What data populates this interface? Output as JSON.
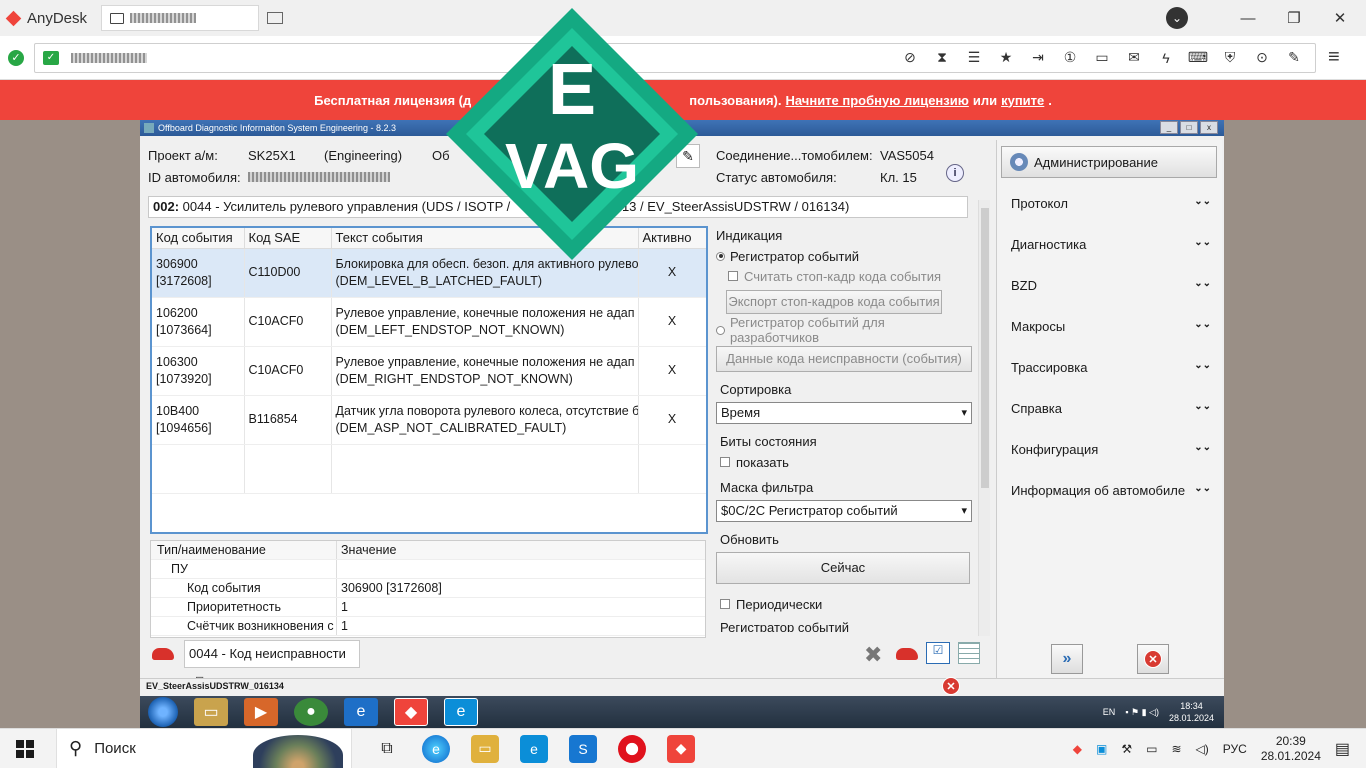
{
  "anydesk": {
    "app_name": "AnyDesk",
    "window_controls": {
      "minimize": "—",
      "maximize": "❐",
      "close": "✕"
    },
    "banner": {
      "text_start": "Бесплатная лицензия (д",
      "text_mid": "пользования).",
      "trial_link": "Начните пробную лицензию",
      "or": "или",
      "buy_link": "купите",
      "end": "."
    },
    "accent_color": "#ef443b"
  },
  "odis": {
    "window_title": "Offboard Diagnostic Information System Engineering - 8.2.3",
    "project_label": "Проект а/м:",
    "project_value": "SK25X1",
    "project_mode": "(Engineering)",
    "project_extra": "Об",
    "vehicle_id_label": "ID автомобиля:",
    "connection_label": "Соединение...томобилем:",
    "connection_value": "VAS5054",
    "vehicle_status_label": "Статус автомобиля:",
    "vehicle_status_value": "Кл. 15",
    "ecu_line_bold": "002:",
    "ecu_line": "0044 - Усилитель рулевого управления  (UDS / ISOTP /",
    "ecu_line_end": "/ 313 / EV_SteerAssisUDSTRW / 016134)",
    "events_table": {
      "headers": [
        "Код события",
        "Код SAE",
        "Текст события",
        "Активно"
      ],
      "rows": [
        {
          "code": "306900",
          "code2": "[3172608]",
          "sae": "C110D00",
          "text1": "Блокировка для обесп. безоп. для активного рулево",
          "text2": "(DEM_LEVEL_B_LATCHED_FAULT)",
          "active": "X"
        },
        {
          "code": "106200",
          "code2": "[1073664]",
          "sae": "C10ACF0",
          "text1": "Рулевое управление, конечные положения не адап",
          "text2": "(DEM_LEFT_ENDSTOP_NOT_KNOWN)",
          "active": "X"
        },
        {
          "code": "106300",
          "code2": "[1073920]",
          "sae": "C10ACF0",
          "text1": "Рулевое управление, конечные положения не адап",
          "text2": "(DEM_RIGHT_ENDSTOP_NOT_KNOWN)",
          "active": "X"
        },
        {
          "code": "10B400",
          "code2": "[1094656]",
          "sae": "B116854",
          "text1": "Датчик угла поворота рулевого колеса, отсутствие б",
          "text2": "(DEM_ASP_NOT_CALIBRATED_FAULT)",
          "active": "X"
        }
      ]
    },
    "props": {
      "headers": [
        "Тип/наименование",
        "Значение"
      ],
      "rows": [
        {
          "name": "ПУ",
          "value": ""
        },
        {
          "name": "Код события",
          "value": "306900 [3172608]"
        },
        {
          "name": "Приоритетность",
          "value": "1"
        },
        {
          "name": "Счётчик возникновения с",
          "value": "1"
        }
      ]
    },
    "options": {
      "indication_label": "Индикация",
      "radio_event_recorder": "Регистратор событий",
      "chk_freeze_frame": "Считать стоп-кадр кода события",
      "btn_export": "Экспорт стоп-кадров кода события",
      "radio_dev_recorder": "Регистратор событий для разработчиков",
      "btn_fault_data": "Данные кода неисправности (события)",
      "sort_label": "Сортировка",
      "sort_value": "Время",
      "status_bits_label": "Биты состояния",
      "chk_show": "показать",
      "filter_label": "Маска фильтра",
      "filter_value": "$0C/2C Регистратор событий",
      "refresh_label": "Обновить",
      "btn_now": "Сейчас",
      "chk_periodic": "Периодически",
      "cut_label": "Регистратор событий"
    },
    "side_menu": {
      "admin": "Администрирование",
      "items": [
        "Протокол",
        "Диагностика",
        "BZD",
        "Макросы",
        "Трассировка",
        "Справка",
        "Конфигурация",
        "Информация об автомобиле"
      ]
    },
    "bottom_tab": "0044 - Код неисправности",
    "status_bar": "EV_SteerAssisUDSTRW_016134"
  },
  "remote_tray": {
    "lang": "EN",
    "time": "18:34",
    "date": "28.01.2024"
  },
  "watermark": {
    "line1": "E",
    "line2": "VAG",
    "color": "#18b48c"
  },
  "taskbar": {
    "search_placeholder": "Поиск",
    "lang": "РУС",
    "time": "20:39",
    "date": "28.01.2024"
  }
}
